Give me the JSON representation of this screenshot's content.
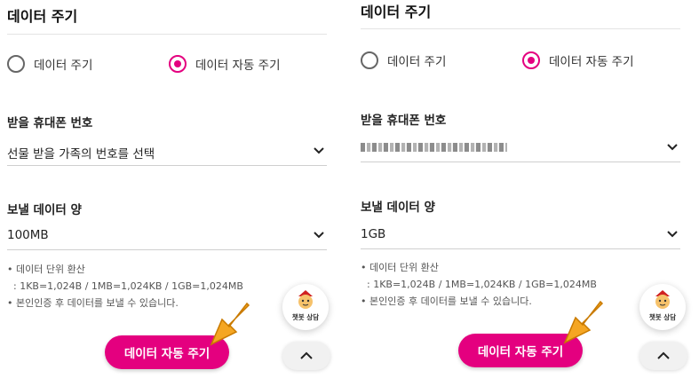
{
  "colors": {
    "accent": "#e4007f",
    "arrow": "#f5a623"
  },
  "panels": [
    {
      "title": "데이터 주기",
      "radios": [
        {
          "label": "데이터 주기",
          "selected": false
        },
        {
          "label": "데이터 자동 주기",
          "selected": true
        }
      ],
      "recipient_label": "받을 휴대폰 번호",
      "recipient_value": "선물 받을 가족의 번호를 선택",
      "amount_label": "보낼 데이터 양",
      "amount_value": "100MB",
      "notes": [
        "• 데이터 단위 환산",
        "  : 1KB=1,024B / 1MB=1,024KB / 1GB=1,024MB",
        "• 본인인증 후 데이터를 보낼 수 있습니다."
      ],
      "cta_label": "데이터 자동 주기",
      "chatbot_label": "챗봇 상담"
    },
    {
      "title": "데이터 주기",
      "radios": [
        {
          "label": "데이터 주기",
          "selected": false
        },
        {
          "label": "데이터 자동 주기",
          "selected": true
        }
      ],
      "recipient_label": "받을 휴대폰 번호",
      "recipient_value": "",
      "amount_label": "보낼 데이터 양",
      "amount_value": "1GB",
      "notes": [
        "• 데이터 단위 환산",
        "  : 1KB=1,024B / 1MB=1,024KB / 1GB=1,024MB",
        "• 본인인증 후 데이터를 보낼 수 있습니다."
      ],
      "cta_label": "데이터 자동 주기",
      "chatbot_label": "챗봇 상담"
    }
  ]
}
